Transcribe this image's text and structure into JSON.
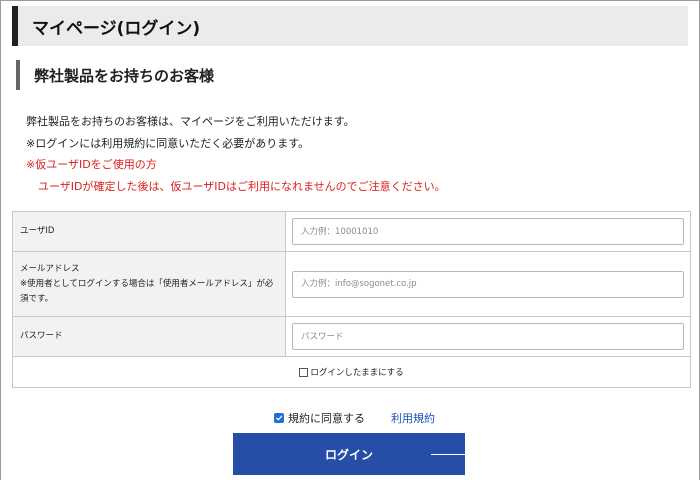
{
  "header": {
    "title": "マイページ(ログイン)"
  },
  "section": {
    "title": "弊社製品をお持ちのお客様"
  },
  "intro": {
    "line1": "弊社製品をお持ちのお客様は、マイページをご利用いただけます。",
    "line2": "※ログインには利用規約に同意いただく必要があります。",
    "notice_title": "※仮ユーザIDをご使用の方",
    "notice_body": "ユーザIDが確定した後は、仮ユーザIDはご利用になれませんのでご注意ください。"
  },
  "form": {
    "user_id": {
      "label": "ユーザID",
      "placeholder": "入力例：10001010",
      "value": ""
    },
    "email": {
      "label": "メールアドレス",
      "note_line1": "※使用者としてログインする場合は「使用者メールアドレス」が必",
      "note_line2": "須です。",
      "placeholder": "入力例：info@sogonet.co.jp",
      "value": ""
    },
    "password": {
      "label": "パスワード",
      "placeholder": "パスワード",
      "value": ""
    },
    "remember": {
      "label": "ログインしたままにする",
      "checked": false
    }
  },
  "agreement": {
    "label": "規約に同意する",
    "checked": true,
    "terms_link": "利用規約"
  },
  "login_button": {
    "label": "ログイン"
  },
  "colors": {
    "accent": "#264ea6",
    "notice": "#d9201e",
    "link": "#1a4fb8",
    "checkbox": "#1f6fd6"
  }
}
